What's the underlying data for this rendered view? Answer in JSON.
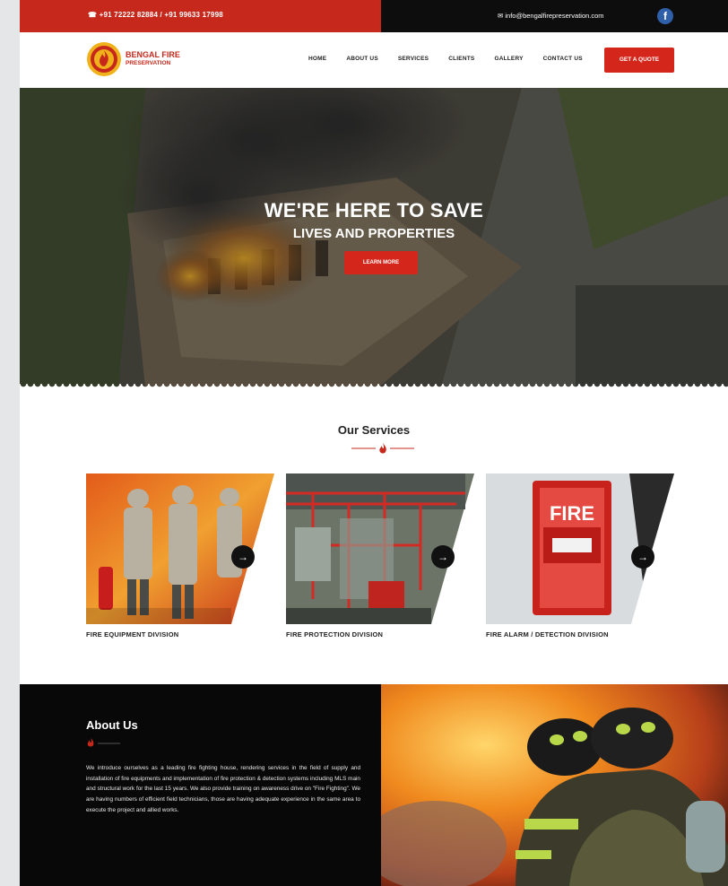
{
  "topbar": {
    "phone": "☎ +91 72222 82884 / +91 99633 17998",
    "email": "✉ info@bengalfirepreservation.com",
    "facebook_icon": "facebook-icon",
    "facebook_glyph": "f",
    "left_color": "#c7281c",
    "right_color": "#0d0d0d"
  },
  "nav": {
    "brand_line1": "BENGAL FIRE",
    "brand_line2": "PRESERVATION",
    "items": [
      "HOME",
      "ABOUT US",
      "SERVICES",
      "CLIENTS",
      "GALLERY",
      "CONTACT US"
    ],
    "cta": "GET A QUOTE",
    "accent": "#d4261b"
  },
  "hero": {
    "title": "WE'RE HERE TO SAVE",
    "subtitle": "LIVES AND PROPERTIES",
    "button": "LEARN MORE"
  },
  "services": {
    "heading": "Our Services",
    "items": [
      {
        "label": "FIRE EQUIPMENT DIVISION",
        "arrow": "→"
      },
      {
        "label": "FIRE PROTECTION DIVISION",
        "arrow": "→"
      },
      {
        "label": "FIRE ALARM / DETECTION DIVISION",
        "arrow": "→"
      }
    ]
  },
  "about": {
    "heading": "About Us",
    "body": "We introduce ourselves as a leading fire fighting house, rendering services in the field of supply and installation of fire equipments and implementation of fire protection & detection systems including MLS main and structural work for the last 15 years. We also provide training on awareness drive on \"Fire Fighting\". We are having numbers of efficient field technicians, those are having adequate experience in the same area to execute the project and allied works."
  }
}
